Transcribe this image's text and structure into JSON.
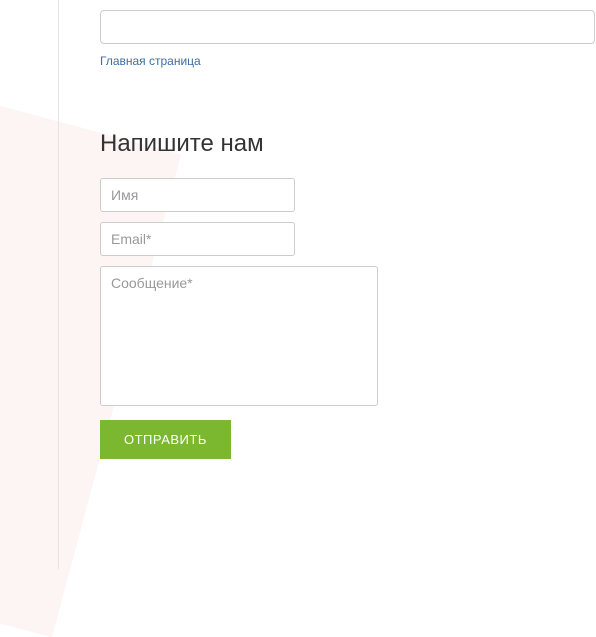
{
  "breadcrumb": {
    "home_label": "Главная страница"
  },
  "form": {
    "heading": "Напишите нам",
    "name_placeholder": "Имя",
    "email_placeholder": "Email*",
    "message_placeholder": "Сообщение*",
    "submit_label": "ОТПРАВИТЬ"
  }
}
